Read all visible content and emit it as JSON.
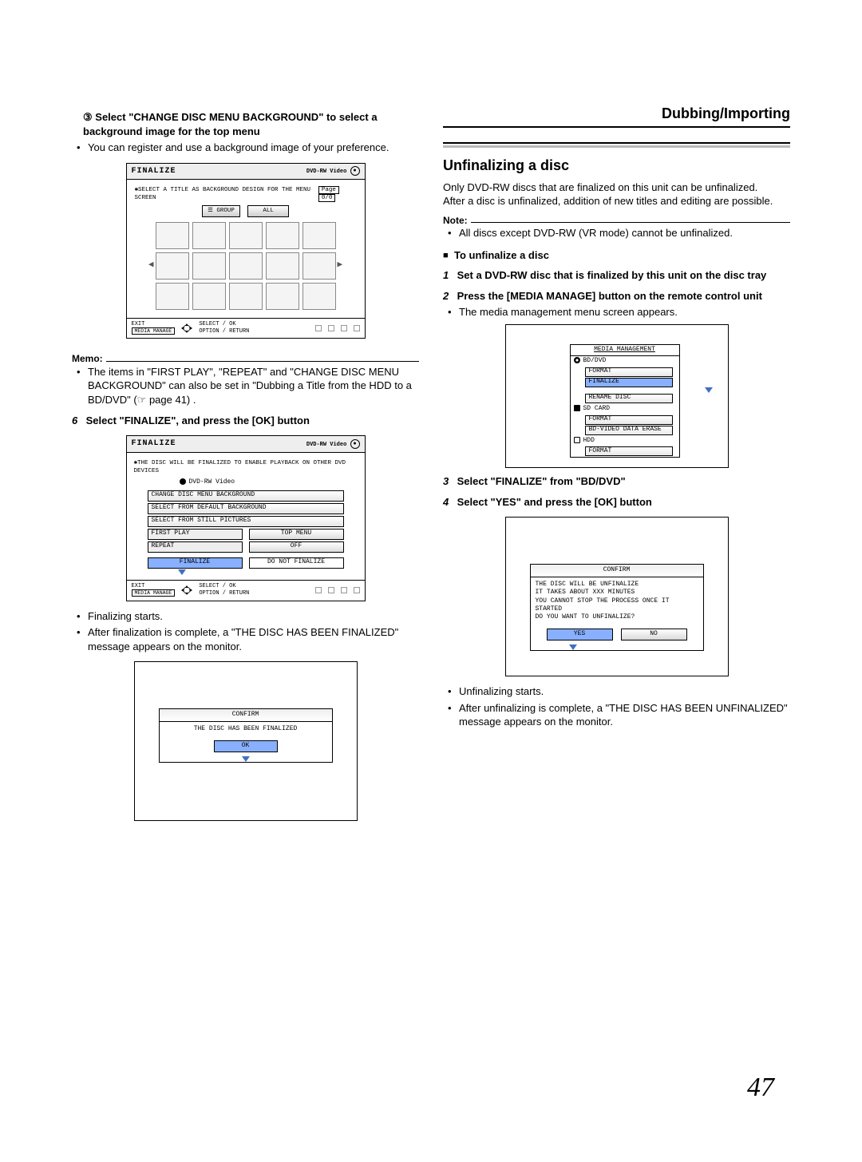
{
  "header": {
    "section": "Dubbing/Importing"
  },
  "left": {
    "step3": {
      "num": "③",
      "title": "Select \"CHANGE DISC MENU BACKGROUND\" to select a background image for the top menu"
    },
    "step3_bullet": "You can register and use a background image of your preference.",
    "thumb": {
      "title": "FINALIZE",
      "disc_label": "DVD-RW Video",
      "hint_star": "✱",
      "hint": "SELECT A TITLE AS BACKGROUND DESIGN FOR THE MENU SCREEN",
      "page_label": "Page",
      "page_val": "0/0",
      "group_btn": "GROUP",
      "all_btn": "ALL",
      "footer_exit": "EXIT",
      "footer_exit_btn": "MEDIA MANAGE",
      "footer_select": "SELECT",
      "footer_ok": "OK",
      "footer_option": "OPTION",
      "footer_return": "RETURN"
    },
    "memo": {
      "label": "Memo:",
      "text_a": "The items in \"FIRST PLAY\", \"REPEAT\" and \"CHANGE DISC MENU BACKGROUND\" can also be set in \"Dubbing a Title from the HDD to a BD/DVD\" (☞ page 41) ."
    },
    "step6": {
      "num": "6",
      "title": "Select \"FINALIZE\", and press the [OK] button"
    },
    "opt": {
      "title": "FINALIZE",
      "disc_label": "DVD-RW Video",
      "hint_star": "✱",
      "hint": "THE DISC WILL BE FINALIZED TO ENABLE PLAYBACK ON OTHER DVD DEVICES",
      "media_row": "DVD-RW Video",
      "rows": [
        "CHANGE DISC MENU BACKGROUND",
        "SELECT FROM DEFAULT BACKGROUND",
        "SELECT FROM STILL PICTURES"
      ],
      "first_play": "FIRST PLAY",
      "first_play_val": "TOP MENU",
      "repeat": "REPEAT",
      "repeat_val": "OFF",
      "finalize": "FINALIZE",
      "donot": "DO NOT FINALIZE",
      "footer_exit": "EXIT",
      "footer_exit_btn": "MEDIA MANAGE",
      "footer_select": "SELECT",
      "footer_ok": "OK",
      "footer_option": "OPTION",
      "footer_return": "RETURN"
    },
    "bullet_fin1": "Finalizing starts.",
    "bullet_fin2": "After finalization is complete, a \"THE DISC HAS BEEN FINALIZED\" message appears on the monitor.",
    "confirm1": {
      "hdr": "CONFIRM",
      "msg": "THE DISC HAS BEEN FINALIZED",
      "ok": "OK"
    }
  },
  "right": {
    "h2": "Unfinalizing a disc",
    "intro1": "Only DVD-RW discs that are finalized on this unit can be unfinalized.",
    "intro2": "After a disc is unfinalized, addition of new titles and editing are possible.",
    "note": {
      "label": "Note:",
      "text": "All discs except DVD-RW (VR mode) cannot be unfinalized."
    },
    "sq_title": "To unfinalize a disc",
    "step1": {
      "num": "1",
      "title": "Set a DVD-RW disc that is finalized by this unit on the disc tray"
    },
    "step2": {
      "num": "2",
      "title": "Press the [MEDIA MANAGE] button on the remote control unit"
    },
    "step2_bullet": "The media management menu screen appears.",
    "mm": {
      "hdr": "MEDIA MANAGEMENT",
      "bd": "BD/DVD",
      "bd_items": [
        "FORMAT",
        "FINALIZE",
        "RENAME DISC"
      ],
      "sd": "SD CARD",
      "sd_items": [
        "FORMAT",
        "BD-VIDEO DATA ERASE"
      ],
      "hdd": "HDD",
      "hdd_items": [
        "FORMAT"
      ]
    },
    "step3": {
      "num": "3",
      "title": "Select \"FINALIZE\" from \"BD/DVD\""
    },
    "step4": {
      "num": "4",
      "title": "Select \"YES\" and press the [OK] button"
    },
    "confirm2": {
      "hdr": "CONFIRM",
      "l1": "THE DISC WILL BE UNFINALIZE",
      "l2": "IT TAKES ABOUT XXX MINUTES",
      "l3": "YOU CANNOT STOP THE PROCESS ONCE IT STARTED",
      "l4": "DO YOU WANT TO UNFINALIZE?",
      "yes": "YES",
      "no": "NO"
    },
    "bullet_u1": "Unfinalizing starts.",
    "bullet_u2": "After unfinalizing is complete, a \"THE DISC HAS BEEN UNFINALIZED\" message appears on the monitor."
  },
  "page_number": "47"
}
